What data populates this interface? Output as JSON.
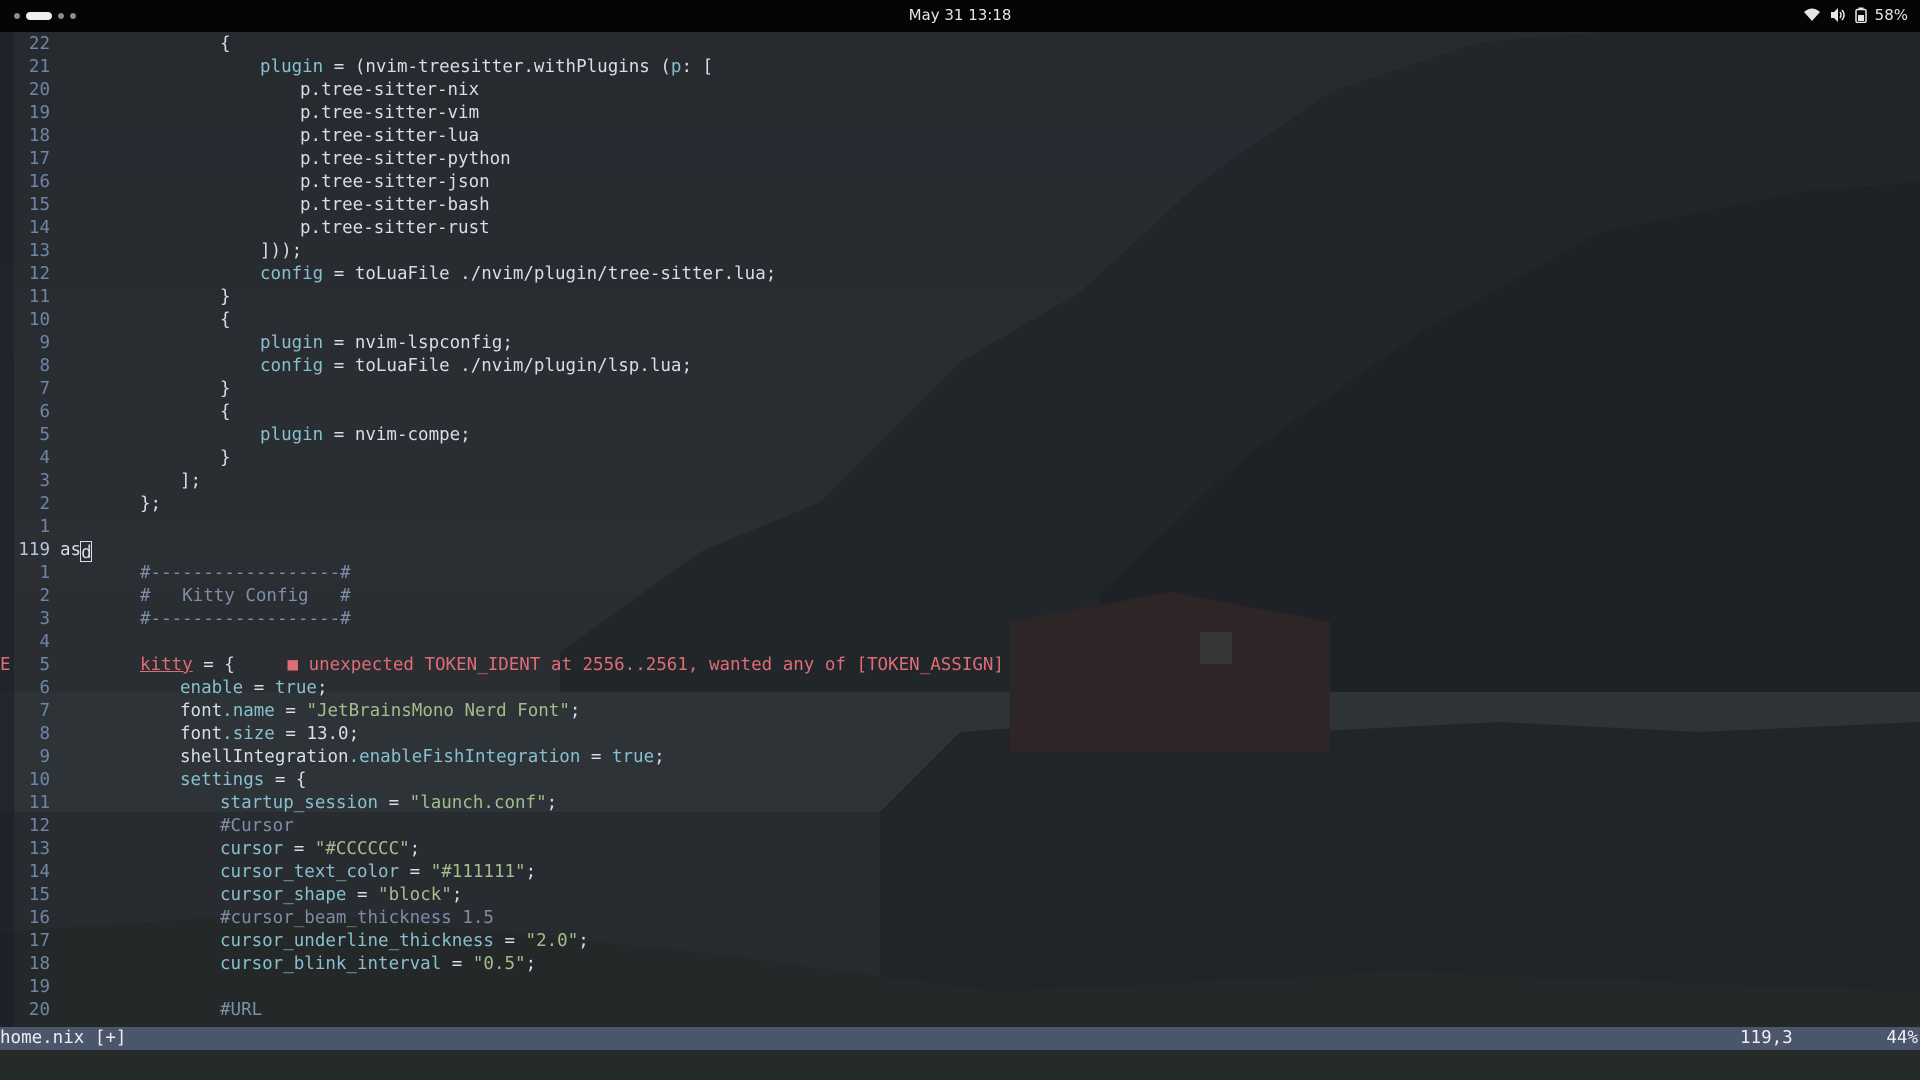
{
  "topbar": {
    "clock": "May 31 13:18",
    "battery": "58%",
    "icons": [
      "wifi-icon",
      "volume-icon",
      "battery-icon"
    ]
  },
  "colors": {
    "keyword": "#88c0d0",
    "string": "#a3be8c",
    "comment": "#7d8ea8",
    "error": "#e06c75",
    "statusline_bg": "#4c566a"
  },
  "editor": {
    "lines": [
      {
        "num": "22",
        "indent": 16,
        "parts": [
          {
            "t": "{"
          }
        ]
      },
      {
        "num": "21",
        "indent": 20,
        "parts": [
          {
            "t": "plugin",
            "c": "kw"
          },
          {
            "t": " = (nvim-treesitter.withPlugins ("
          },
          {
            "t": "p",
            "c": "kw"
          },
          {
            "t": ": ["
          }
        ]
      },
      {
        "num": "20",
        "indent": 24,
        "parts": [
          {
            "t": "p.tree-sitter-nix"
          }
        ]
      },
      {
        "num": "19",
        "indent": 24,
        "parts": [
          {
            "t": "p.tree-sitter-vim"
          }
        ]
      },
      {
        "num": "18",
        "indent": 24,
        "parts": [
          {
            "t": "p.tree-sitter-lua"
          }
        ]
      },
      {
        "num": "17",
        "indent": 24,
        "parts": [
          {
            "t": "p.tree-sitter-python"
          }
        ]
      },
      {
        "num": "16",
        "indent": 24,
        "parts": [
          {
            "t": "p.tree-sitter-json"
          }
        ]
      },
      {
        "num": "15",
        "indent": 24,
        "parts": [
          {
            "t": "p.tree-sitter-bash"
          }
        ]
      },
      {
        "num": "14",
        "indent": 24,
        "parts": [
          {
            "t": "p.tree-sitter-rust"
          }
        ]
      },
      {
        "num": "13",
        "indent": 20,
        "parts": [
          {
            "t": "]));"
          }
        ]
      },
      {
        "num": "12",
        "indent": 20,
        "parts": [
          {
            "t": "config",
            "c": "kw"
          },
          {
            "t": " = toLuaFile ./nvim/plugin/tree-sitter.lua;"
          }
        ]
      },
      {
        "num": "11",
        "indent": 16,
        "parts": [
          {
            "t": "}"
          }
        ]
      },
      {
        "num": "10",
        "indent": 16,
        "parts": [
          {
            "t": "{"
          }
        ]
      },
      {
        "num": "9",
        "indent": 20,
        "parts": [
          {
            "t": "plugin",
            "c": "kw"
          },
          {
            "t": " = nvim-lspconfig;"
          }
        ]
      },
      {
        "num": "8",
        "indent": 20,
        "parts": [
          {
            "t": "config",
            "c": "kw"
          },
          {
            "t": " = toLuaFile ./nvim/plugin/lsp.lua;"
          }
        ]
      },
      {
        "num": "7",
        "indent": 16,
        "parts": [
          {
            "t": "}"
          }
        ]
      },
      {
        "num": "6",
        "indent": 16,
        "parts": [
          {
            "t": "{"
          }
        ]
      },
      {
        "num": "5",
        "indent": 20,
        "parts": [
          {
            "t": "plugin",
            "c": "kw"
          },
          {
            "t": " = nvim-compe;"
          }
        ]
      },
      {
        "num": "4",
        "indent": 16,
        "parts": [
          {
            "t": "}"
          }
        ]
      },
      {
        "num": "3",
        "indent": 12,
        "parts": [
          {
            "t": "];"
          }
        ]
      },
      {
        "num": "2",
        "indent": 8,
        "parts": [
          {
            "t": "};"
          }
        ]
      },
      {
        "num": "1",
        "indent": 0,
        "parts": []
      },
      {
        "num": "119",
        "indent": 0,
        "current": true,
        "parts": [
          {
            "t": "as"
          },
          {
            "t": "d",
            "cursor": true
          }
        ]
      },
      {
        "num": "1",
        "indent": 8,
        "parts": [
          {
            "t": "#------------------#",
            "c": "cmt"
          }
        ]
      },
      {
        "num": "2",
        "indent": 8,
        "parts": [
          {
            "t": "#   Kitty Config   #",
            "c": "cmt"
          }
        ]
      },
      {
        "num": "3",
        "indent": 8,
        "parts": [
          {
            "t": "#------------------#",
            "c": "cmt"
          }
        ]
      },
      {
        "num": "4",
        "indent": 0,
        "parts": []
      },
      {
        "num": "5",
        "indent": 8,
        "sign": "E",
        "parts": [
          {
            "t": "kitty",
            "c": "err"
          },
          {
            "t": " = {     "
          },
          {
            "t": "■ unexpected TOKEN_IDENT at 2556..2561, wanted any of [TOKEN_ASSIGN]",
            "c": "diag"
          }
        ]
      },
      {
        "num": "6",
        "indent": 12,
        "parts": [
          {
            "t": "enable",
            "c": "kw"
          },
          {
            "t": " = "
          },
          {
            "t": "true",
            "c": "kw"
          },
          {
            "t": ";"
          }
        ]
      },
      {
        "num": "7",
        "indent": 12,
        "parts": [
          {
            "t": "font"
          },
          {
            "t": ".name",
            "c": "kw"
          },
          {
            "t": " = "
          },
          {
            "t": "\"JetBrainsMono Nerd Font\"",
            "c": "str"
          },
          {
            "t": ";"
          }
        ]
      },
      {
        "num": "8",
        "indent": 12,
        "parts": [
          {
            "t": "font"
          },
          {
            "t": ".size",
            "c": "kw"
          },
          {
            "t": " = 13.0;"
          }
        ]
      },
      {
        "num": "9",
        "indent": 12,
        "parts": [
          {
            "t": "shellIntegration"
          },
          {
            "t": ".enableFishIntegration",
            "c": "kw"
          },
          {
            "t": " = "
          },
          {
            "t": "true",
            "c": "kw"
          },
          {
            "t": ";"
          }
        ]
      },
      {
        "num": "10",
        "indent": 12,
        "parts": [
          {
            "t": "settings",
            "c": "kw"
          },
          {
            "t": " = {"
          }
        ]
      },
      {
        "num": "11",
        "indent": 16,
        "parts": [
          {
            "t": "startup_session",
            "c": "kw"
          },
          {
            "t": " = "
          },
          {
            "t": "\"launch.conf\"",
            "c": "str"
          },
          {
            "t": ";"
          }
        ]
      },
      {
        "num": "12",
        "indent": 16,
        "parts": [
          {
            "t": "#Cursor",
            "c": "cmt"
          }
        ]
      },
      {
        "num": "13",
        "indent": 16,
        "parts": [
          {
            "t": "cursor",
            "c": "kw"
          },
          {
            "t": " = "
          },
          {
            "t": "\"#CCCCCC\"",
            "c": "str"
          },
          {
            "t": ";"
          }
        ]
      },
      {
        "num": "14",
        "indent": 16,
        "parts": [
          {
            "t": "cursor_text_color",
            "c": "kw"
          },
          {
            "t": " = "
          },
          {
            "t": "\"#111111\"",
            "c": "str"
          },
          {
            "t": ";"
          }
        ]
      },
      {
        "num": "15",
        "indent": 16,
        "parts": [
          {
            "t": "cursor_shape",
            "c": "kw"
          },
          {
            "t": " = "
          },
          {
            "t": "\"block\"",
            "c": "str"
          },
          {
            "t": ";"
          }
        ]
      },
      {
        "num": "16",
        "indent": 16,
        "parts": [
          {
            "t": "#cursor_beam_thickness 1.5",
            "c": "cmt"
          }
        ]
      },
      {
        "num": "17",
        "indent": 16,
        "parts": [
          {
            "t": "cursor_underline_thickness",
            "c": "kw"
          },
          {
            "t": " = "
          },
          {
            "t": "\"2.0\"",
            "c": "str"
          },
          {
            "t": ";"
          }
        ]
      },
      {
        "num": "18",
        "indent": 16,
        "parts": [
          {
            "t": "cursor_blink_interval",
            "c": "kw"
          },
          {
            "t": " = "
          },
          {
            "t": "\"0.5\"",
            "c": "str"
          },
          {
            "t": ";"
          }
        ]
      },
      {
        "num": "19",
        "indent": 0,
        "parts": []
      },
      {
        "num": "20",
        "indent": 16,
        "parts": [
          {
            "t": "#URL",
            "c": "cmt"
          }
        ]
      }
    ]
  },
  "statusline": {
    "file": "home.nix [+]",
    "position": "119,3",
    "percent": "44%"
  }
}
